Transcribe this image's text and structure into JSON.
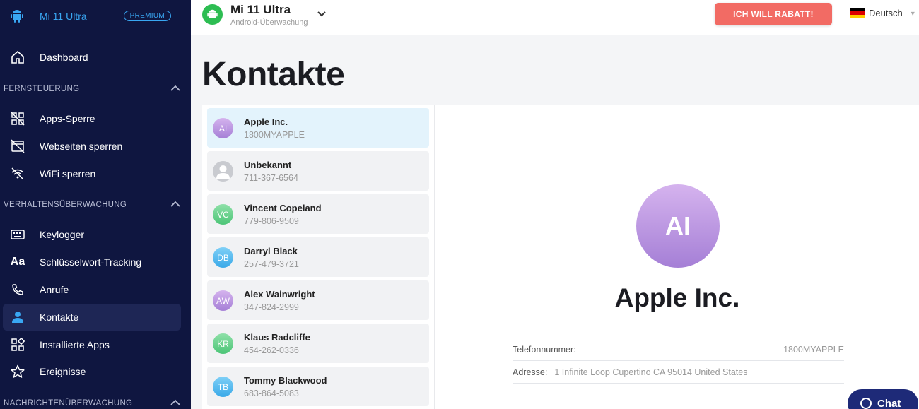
{
  "sidebar": {
    "device_name": "Mi 11 Ultra",
    "premium_badge": "PREMIUM",
    "dashboard": "Dashboard",
    "sections": [
      {
        "title": "FERNSTEUERUNG",
        "items": [
          "Apps-Sperre",
          "Webseiten sperren",
          "WiFi sperren"
        ]
      },
      {
        "title": "VERHALTENSÜBERWACHUNG",
        "items": [
          "Keylogger",
          "Schlüsselwort-Tracking",
          "Anrufe",
          "Kontakte",
          "Installierte Apps",
          "Ereignisse"
        ]
      },
      {
        "title": "NACHRICHTENÜBERWACHUNG",
        "items": []
      }
    ],
    "active_item": "Kontakte"
  },
  "header": {
    "device_title": "Mi 11 Ultra",
    "device_subtitle": "Android-Überwachung",
    "promo_button": "ICH WILL RABATT!",
    "language": "Deutsch"
  },
  "page_title": "Kontakte",
  "contacts": [
    {
      "initials": "AI",
      "name": "Apple Inc.",
      "phone": "1800MYAPPLE",
      "color": "#b58ee0",
      "selected": true
    },
    {
      "initials": "",
      "name": "Unbekannt",
      "phone": "711-367-6564",
      "color": "#c9cbd0",
      "selected": false
    },
    {
      "initials": "VC",
      "name": "Vincent Copeland",
      "phone": "779-806-9509",
      "color": "#5fcf86",
      "selected": false
    },
    {
      "initials": "DB",
      "name": "Darryl Black",
      "phone": "257-479-3721",
      "color": "#4db6ee",
      "selected": false
    },
    {
      "initials": "AW",
      "name": "Alex Wainwright",
      "phone": "347-824-2999",
      "color": "#b58ee0",
      "selected": false
    },
    {
      "initials": "KR",
      "name": "Klaus Radcliffe",
      "phone": "454-262-0336",
      "color": "#5fcf86",
      "selected": false
    },
    {
      "initials": "TB",
      "name": "Tommy Blackwood",
      "phone": "683-864-5083",
      "color": "#4db6ee",
      "selected": false
    }
  ],
  "detail": {
    "initials": "AI",
    "name": "Apple Inc.",
    "phone_label": "Telefonnummer:",
    "phone_value": "1800MYAPPLE",
    "address_label": "Adresse:",
    "address_value": "1 Infinite Loop Cupertino CA 95014 United States"
  },
  "chat_button": "Chat",
  "colors": {
    "sidebar_bg": "#0f1640",
    "accent": "#39a7f3",
    "promo": "#f26b64",
    "device_green": "#2dbd52",
    "chat_bg": "#1e2a78"
  }
}
